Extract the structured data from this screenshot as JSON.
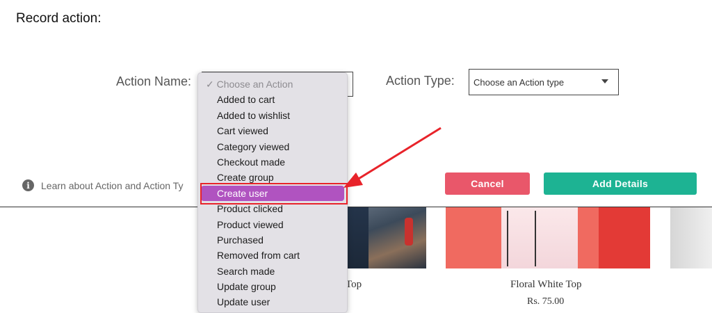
{
  "page": {
    "heading": "Record action:"
  },
  "form": {
    "action_name_label": "Action Name:",
    "action_type_label": "Action Type:",
    "action_type_placeholder": "Choose an Action type"
  },
  "info": {
    "text": "Learn about Action and Action Ty"
  },
  "buttons": {
    "cancel": "Cancel",
    "add_details": "Add Details"
  },
  "colors": {
    "cancel": "#e9576a",
    "add_details": "#1db393",
    "selected_option": "#b053c0",
    "annotation": "#e8232a"
  },
  "dropdown": {
    "placeholder": "✓ Choose an Action",
    "options": [
      "Added to cart",
      "Added to wishlist",
      "Cart viewed",
      "Category viewed",
      "Checkout made",
      "Create group",
      "Create user",
      "Product clicked",
      "Product viewed",
      "Purchased",
      "Removed from cart",
      "Search made",
      "Update group",
      "Update user"
    ],
    "selected": "Create user"
  },
  "products": [
    {
      "name_fragment": "Top"
    },
    {
      "name": "Floral White Top",
      "price": "Rs. 75.00"
    }
  ]
}
